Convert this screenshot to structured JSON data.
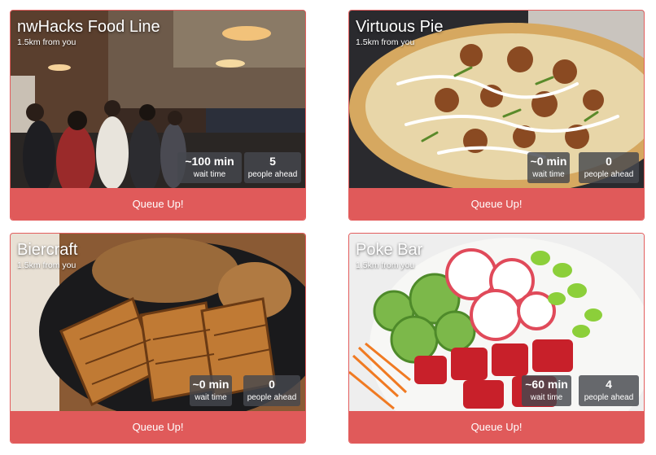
{
  "restaurants": [
    {
      "name": "nwHacks Food Line",
      "distance": "1.5km from you",
      "wait_value": "~100 min",
      "wait_label": "wait time",
      "people_value": "5",
      "people_label": "people ahead",
      "button": "Queue Up!"
    },
    {
      "name": "Virtuous Pie",
      "distance": "1.5km from you",
      "wait_value": "~0 min",
      "wait_label": "wait time",
      "people_value": "0",
      "people_label": "people ahead",
      "button": "Queue Up!"
    },
    {
      "name": "Biercraft",
      "distance": "1.5km from you",
      "wait_value": "~0 min",
      "wait_label": "wait time",
      "people_value": "0",
      "people_label": "people ahead",
      "button": "Queue Up!"
    },
    {
      "name": "Poke Bar",
      "distance": "1.5km from you",
      "wait_value": "~60 min",
      "wait_label": "wait time",
      "people_value": "4",
      "people_label": "people ahead",
      "button": "Queue Up!"
    }
  ],
  "colors": {
    "accent": "#e05a5a",
    "border": "#e35d5d",
    "stat_overlay": "#46484e"
  }
}
